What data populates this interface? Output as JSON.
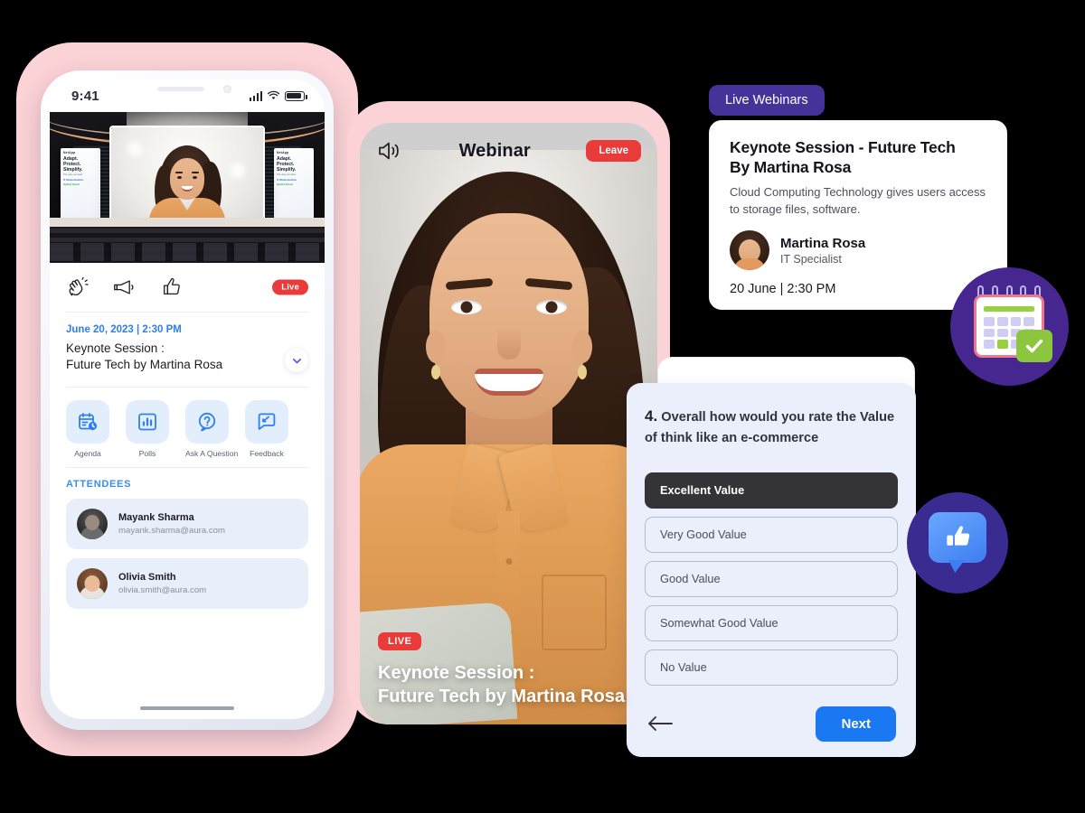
{
  "phone_left": {
    "status": {
      "time": "9:41",
      "signal_icon": "signal-bars-icon",
      "wifi_icon": "wifi-icon",
      "battery_icon": "battery-icon"
    },
    "stage": {
      "banner_brand": "NetApp",
      "banner_line1": "Adapt.",
      "banner_line2": "Protect.",
      "banner_line3": "Simplify.",
      "banner_tagline": "The way you want.",
      "banner_link1": "IT Modernization",
      "banner_link2": "Hybrid Cloud"
    },
    "reactions": [
      {
        "name": "clap-icon",
        "label": "Clap"
      },
      {
        "name": "megaphone-icon",
        "label": "Announce"
      },
      {
        "name": "thumbs-up-icon",
        "label": "Like"
      }
    ],
    "live_pill": "Live",
    "session": {
      "date": "June 20, 2023 | 2:30 PM",
      "title_line1": "Keynote Session :",
      "title_line2": "Future Tech by Martina Rosa",
      "expand_icon": "chevron-down-icon"
    },
    "actions": [
      {
        "label": "Agenda",
        "icon": "calendar-clock-icon"
      },
      {
        "label": "Polls",
        "icon": "bar-chart-icon"
      },
      {
        "label": "Ask A Question",
        "icon": "question-circle-icon"
      },
      {
        "label": "Feedback",
        "icon": "feedback-pencil-icon"
      }
    ],
    "attendees_header": "ATTENDEES",
    "attendees": [
      {
        "name": "Mayank Sharma",
        "email": "mayank.sharma@aura.com"
      },
      {
        "name": "Olivia Smith",
        "email": "olivia.smith@aura.com"
      }
    ]
  },
  "phone_right": {
    "speaker_icon": "speaker-volume-icon",
    "title": "Webinar",
    "leave_label": "Leave",
    "live_badge": "LIVE",
    "caption_line1": "Keynote Session :",
    "caption_line2": "Future Tech by Martina Rosa"
  },
  "live_webinars": {
    "badge": "Live Webinars",
    "card": {
      "title_line1": "Keynote Session - Future Tech",
      "title_line2": "By Martina Rosa",
      "description": "Cloud Computing Technology gives users access to storage files, software.",
      "speaker_name": "Martina Rosa",
      "speaker_role": "IT Specialist",
      "datetime": "20 June | 2:30 PM"
    }
  },
  "survey": {
    "question_number": "4.",
    "question_text": "Overall how would you rate the Value of think like an e-commerce",
    "options": [
      {
        "label": "Excellent Value",
        "selected": true
      },
      {
        "label": "Very Good Value",
        "selected": false
      },
      {
        "label": "Good Value",
        "selected": false
      },
      {
        "label": "Somewhat Good Value",
        "selected": false
      },
      {
        "label": "No Value",
        "selected": false
      }
    ],
    "back_icon": "arrow-left-icon",
    "next_label": "Next"
  },
  "badges": {
    "calendar_icon": "calendar-check-icon",
    "like_icon": "thumbs-up-bubble-icon"
  },
  "colors": {
    "phone_frame_pink": "#fbd2d6",
    "accent_blue": "#2f80ed",
    "next_blue": "#1a79f2",
    "live_red": "#ea3b3b",
    "badge_purple": "#45339a",
    "circle_purple": "#46268f",
    "survey_bg": "#eaeffb",
    "selected_dark": "#333338",
    "check_green": "#8cc63f"
  }
}
